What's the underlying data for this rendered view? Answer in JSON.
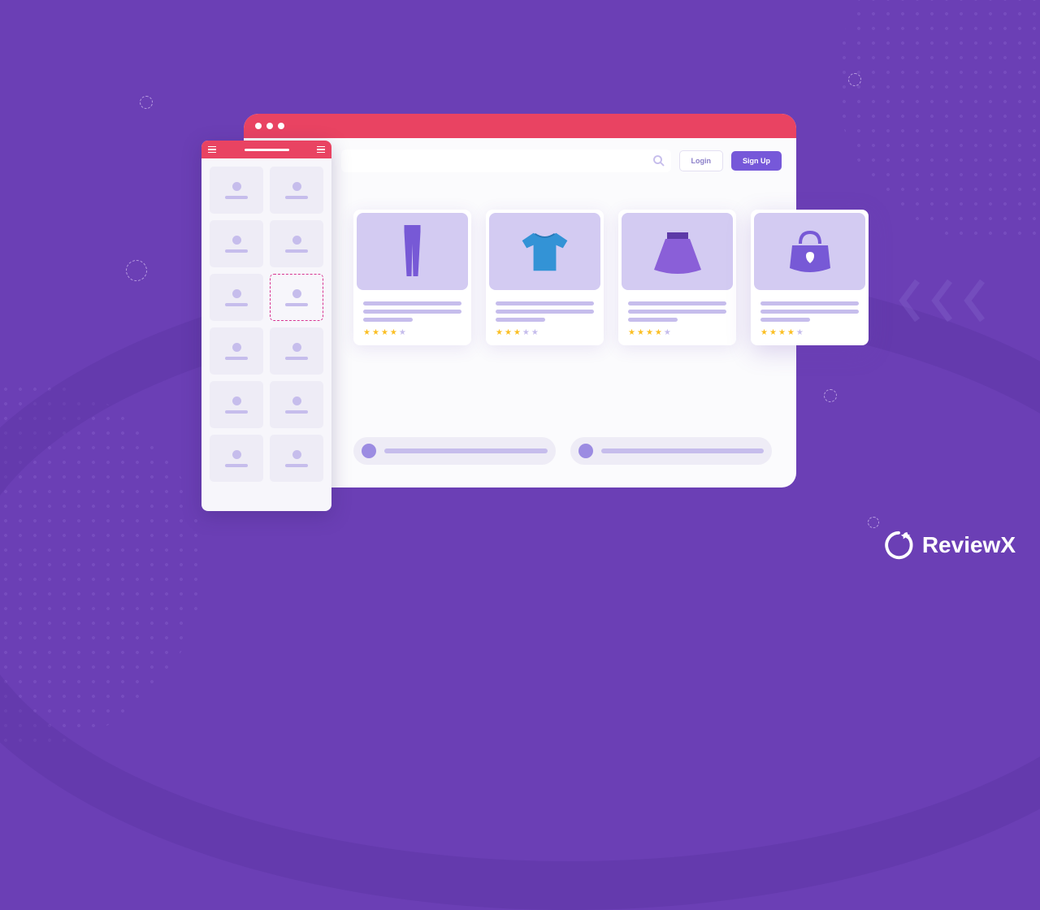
{
  "brand": {
    "name": "ReviewX"
  },
  "header": {
    "login_label": "Login",
    "signup_label": "Sign Up"
  },
  "products": [
    {
      "icon": "pants-icon",
      "rating_filled": 4,
      "rating_total": 5
    },
    {
      "icon": "tshirt-icon",
      "rating_filled": 3,
      "rating_total": 5
    },
    {
      "icon": "skirt-icon",
      "rating_filled": 4,
      "rating_total": 5
    },
    {
      "icon": "handbag-icon",
      "rating_filled": 4,
      "rating_total": 5
    }
  ],
  "sidebar": {
    "items": 12,
    "dragging_index": 5
  },
  "colors": {
    "accent": "#e94362",
    "primary": "#7658d9",
    "bg": "#6b3fb5"
  }
}
